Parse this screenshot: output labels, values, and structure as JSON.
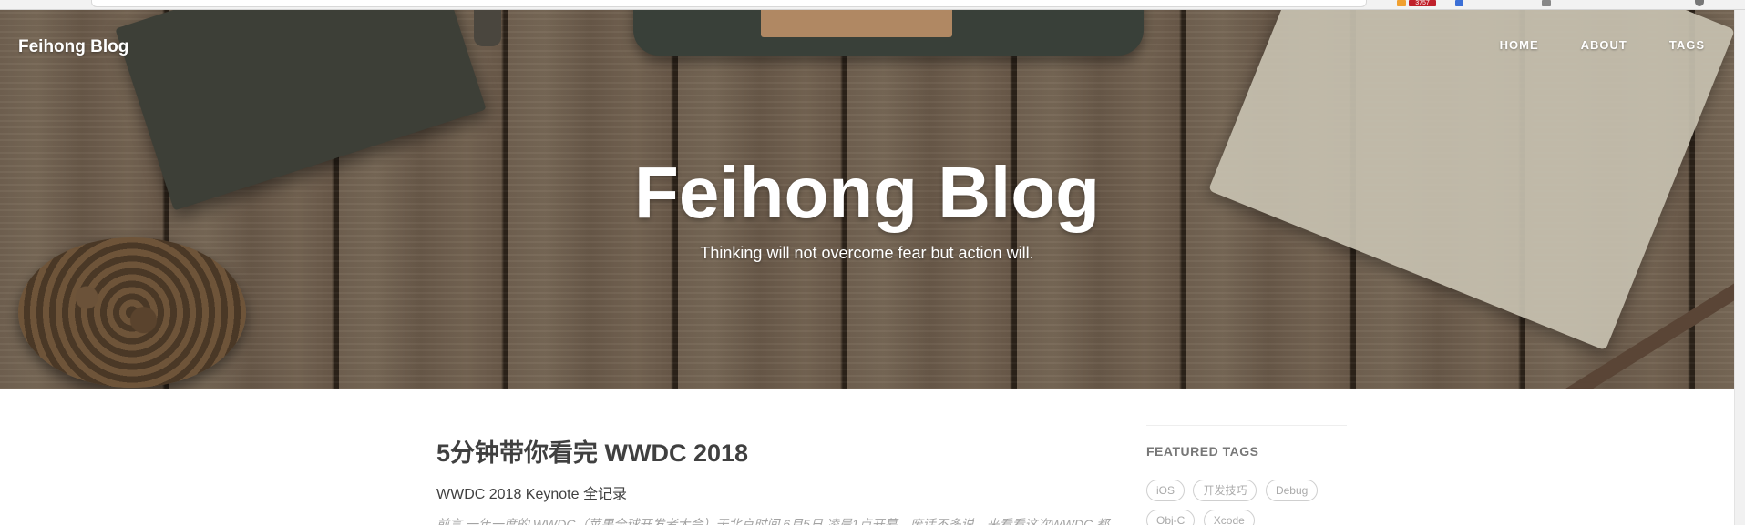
{
  "browser_strip": {
    "badge_counter": "3757"
  },
  "navbar": {
    "brand": "Feihong Blog",
    "links": [
      {
        "label": "HOME"
      },
      {
        "label": "ABOUT"
      },
      {
        "label": "TAGS"
      }
    ]
  },
  "hero": {
    "title": "Feihong Blog",
    "subtitle": "Thinking will not overcome fear but action will."
  },
  "post": {
    "title": "5分钟带你看完 WWDC 2018",
    "subtitle": "WWDC 2018 Keynote 全记录",
    "excerpt": "前言 一年一度的 WWDC（苹果全球开发者大会）于北京时间 6月5日 凌晨1点开幕。废话不多说，来看看这次WWDC 都"
  },
  "sidebar": {
    "heading": "FEATURED TAGS",
    "tags": [
      "iOS",
      "开发技巧",
      "Debug",
      "Obj-C",
      "Xcode"
    ]
  }
}
